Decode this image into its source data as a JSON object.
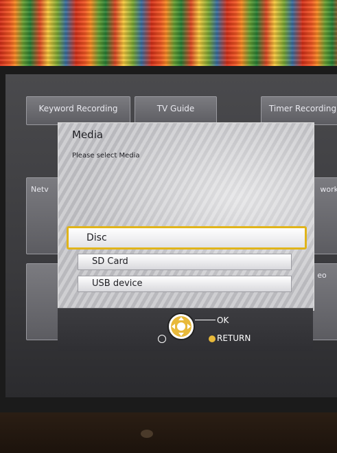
{
  "menu_tiles": {
    "keyword_recording": "Keyword Recording",
    "tv_guide": "TV Guide",
    "timer_recording": "Timer Recording",
    "network_left": "Netv",
    "network_right": "work",
    "right_low": "eo"
  },
  "dialog": {
    "title": "Media",
    "subtitle": "Please select Media",
    "options": [
      {
        "label": "Disc",
        "selected": true
      },
      {
        "label": "SD Card",
        "selected": false
      },
      {
        "label": "USB device",
        "selected": false
      }
    ]
  },
  "footer": {
    "ok_label": "OK",
    "return_label": "RETURN"
  },
  "colors": {
    "selection_border": "#e0b41a",
    "return_button": "#e8b93a"
  }
}
